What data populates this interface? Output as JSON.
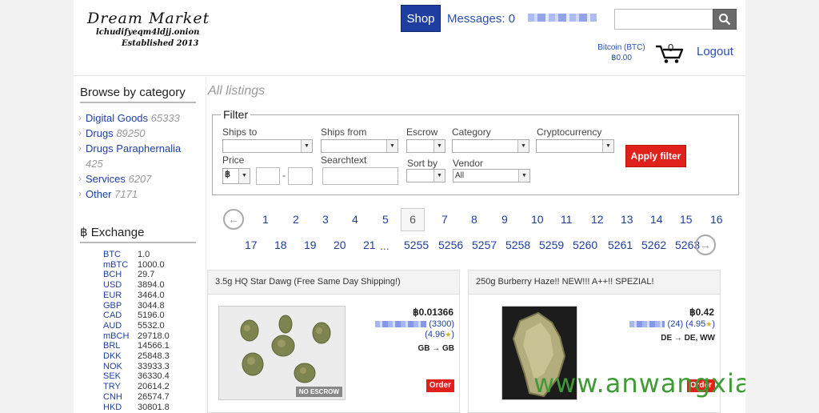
{
  "header": {
    "site_name": "Dream Market",
    "onion_address": "lchudifyeqm4ldjj.onion",
    "established": "Established 2013",
    "shop_label": "Shop",
    "messages_label": "Messages: 0",
    "search_placeholder": "",
    "bitcoin_label": "Bitcoin (BTC)",
    "balance": "฿0.00",
    "cart_count": "0",
    "logout_label": "Logout"
  },
  "sidebar": {
    "category_heading": "Browse by category",
    "categories": [
      {
        "name": "Digital Goods",
        "count": "65333"
      },
      {
        "name": "Drugs",
        "count": "89250"
      },
      {
        "name": "Drugs Paraphernalia",
        "count": "425"
      },
      {
        "name": "Services",
        "count": "6207"
      },
      {
        "name": "Other",
        "count": "7171"
      }
    ],
    "exchange_heading": "฿ Exchange",
    "rates": [
      {
        "cur": "BTC",
        "val": "1.0"
      },
      {
        "cur": "mBTC",
        "val": "1000.0"
      },
      {
        "cur": "BCH",
        "val": "29.7"
      },
      {
        "cur": "USD",
        "val": "3894.0"
      },
      {
        "cur": "EUR",
        "val": "3464.0"
      },
      {
        "cur": "GBP",
        "val": "3044.8"
      },
      {
        "cur": "CAD",
        "val": "5196.0"
      },
      {
        "cur": "AUD",
        "val": "5532.0"
      },
      {
        "cur": "mBCH",
        "val": "29718.0"
      },
      {
        "cur": "BRL",
        "val": "14566.1"
      },
      {
        "cur": "DKK",
        "val": "25848.3"
      },
      {
        "cur": "NOK",
        "val": "33933.3"
      },
      {
        "cur": "SEK",
        "val": "36330.4"
      },
      {
        "cur": "TRY",
        "val": "20614.2"
      },
      {
        "cur": "CNH",
        "val": "26574.7"
      },
      {
        "cur": "HKD",
        "val": "30801.8"
      }
    ]
  },
  "main": {
    "all_listings": "All listings",
    "filter": {
      "legend": "Filter",
      "ships_to": "Ships to",
      "ships_from": "Ships from",
      "escrow": "Escrow",
      "category": "Category",
      "cryptocurrency": "Cryptocurrency",
      "price": "Price",
      "price_currency": "฿",
      "price_dash": "-",
      "searchtext": "Searchtext",
      "sort_by": "Sort by",
      "vendor": "Vendor",
      "vendor_value": "All",
      "apply_label": "Apply filter"
    },
    "pagination": {
      "prev_arrow": "←",
      "next_arrow": "→",
      "row1": [
        "1",
        "2",
        "3",
        "4",
        "5",
        "6",
        "7",
        "8",
        "9",
        "10",
        "11",
        "12",
        "13",
        "14",
        "15",
        "16"
      ],
      "ellipsis": "...",
      "row2": [
        "17",
        "18",
        "19",
        "20",
        "21",
        "5255",
        "5256",
        "5257",
        "5258",
        "5259",
        "5260",
        "5261",
        "5262",
        "5263"
      ]
    },
    "listings": [
      {
        "title": "3.5g HQ Star Dawg (Free Same Day Shipping!)",
        "price": "฿0.01366",
        "vendor_reviews": "(3300)",
        "vendor_rating": "(4.96",
        "shipping": "GB → GB",
        "badge": "NO ESCROW",
        "order_label": "Order"
      },
      {
        "title": "250g Burberry Haze!! NEW!!! A++!! SPEZIAL!",
        "price": "฿0.42",
        "vendor_reviews": "(24)",
        "vendor_rating": "(4.95",
        "shipping": "DE → DE, WW",
        "order_label": "Order"
      }
    ],
    "watermark": "www.anwangxia.com"
  }
}
